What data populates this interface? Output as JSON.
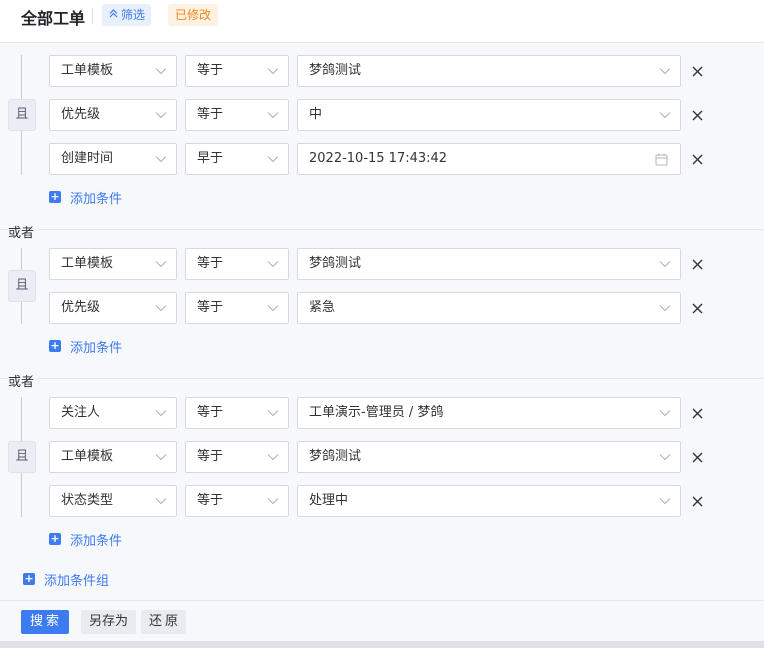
{
  "header": {
    "title": "全部工单",
    "filter_label": "筛选",
    "modified_label": "已修改"
  },
  "and_label": "且",
  "or_label": "或者",
  "add_condition_label": "添加条件",
  "add_group_label": "添加条件组",
  "groups": [
    {
      "rows": [
        {
          "field": "工单模板",
          "op": "等于",
          "value": "梦鸽测试",
          "value_type": "select"
        },
        {
          "field": "优先级",
          "op": "等于",
          "value": "中",
          "value_type": "select"
        },
        {
          "field": "创建时间",
          "op": "早于",
          "value": "2022-10-15 17:43:42",
          "value_type": "date"
        }
      ]
    },
    {
      "rows": [
        {
          "field": "工单模板",
          "op": "等于",
          "value": "梦鸽测试",
          "value_type": "select"
        },
        {
          "field": "优先级",
          "op": "等于",
          "value": "紧急",
          "value_type": "select"
        }
      ]
    },
    {
      "rows": [
        {
          "field": "关注人",
          "op": "等于",
          "value": "工单演示-管理员 / 梦鸽",
          "value_type": "select"
        },
        {
          "field": "工单模板",
          "op": "等于",
          "value": "梦鸽测试",
          "value_type": "select"
        },
        {
          "field": "状态类型",
          "op": "等于",
          "value": "处理中",
          "value_type": "select"
        }
      ]
    }
  ],
  "footer": {
    "search_label": "搜索",
    "save_as_label": "另存为",
    "reset_label": "还原"
  },
  "colors": {
    "accent": "#3d7bf0",
    "modified": "#f08a24"
  }
}
